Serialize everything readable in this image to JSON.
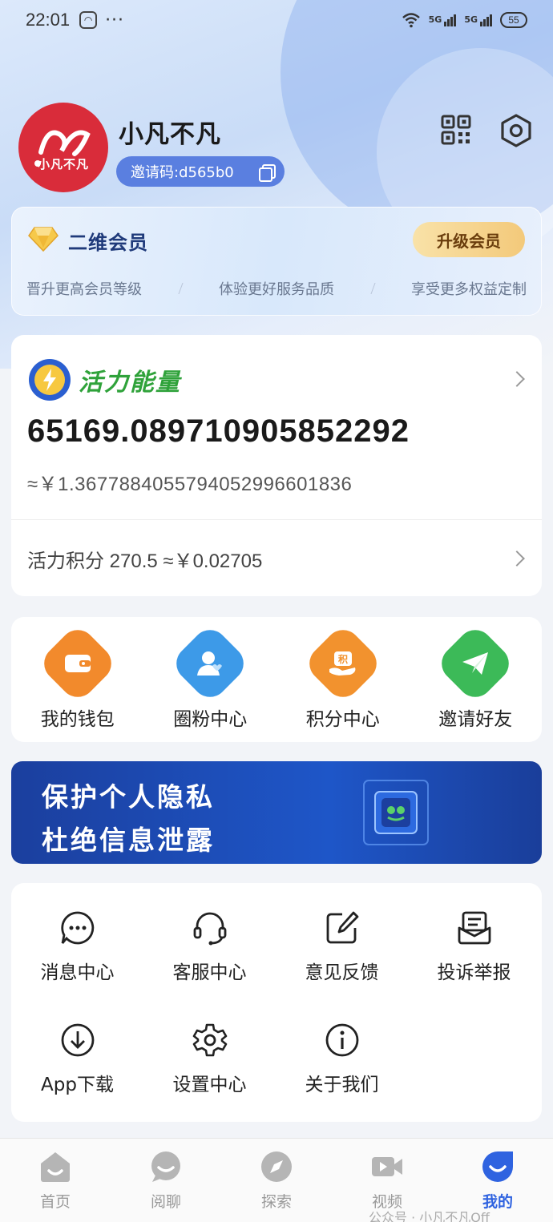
{
  "status_bar": {
    "time": "22:01",
    "dots": "···",
    "signal1": "5G",
    "signal2": "5G",
    "battery": "55"
  },
  "profile": {
    "avatar_text": "小凡不凡",
    "username": "小凡不凡",
    "invite_code": "邀请码:d565b0"
  },
  "membership": {
    "title": "二维会员",
    "upgrade_label": "升级会员",
    "benefits": [
      "晋升更高会员等级",
      "体验更好服务品质",
      "享受更多权益定制"
    ]
  },
  "energy": {
    "title": "活力能量",
    "value": "65169.089710905852292",
    "yuan_value": "≈￥1.3677884055794052996601836",
    "points_text": "活力积分 270.5 ≈￥0.02705"
  },
  "quick_actions": [
    {
      "label": "我的钱包",
      "icon": "wallet-icon",
      "color": "#f28a2c"
    },
    {
      "label": "圈粉中心",
      "icon": "fans-icon",
      "color": "#3d9ae8"
    },
    {
      "label": "积分中心",
      "icon": "points-icon",
      "color": "#f2922e"
    },
    {
      "label": "邀请好友",
      "icon": "paper-plane-icon",
      "color": "#3cba58"
    }
  ],
  "banner": {
    "line1": "保护个人隐私",
    "line2": "杜绝信息泄露"
  },
  "services": [
    {
      "label": "消息中心",
      "icon": "message-icon"
    },
    {
      "label": "客服中心",
      "icon": "headset-icon"
    },
    {
      "label": "意见反馈",
      "icon": "feedback-edit-icon"
    },
    {
      "label": "投诉举报",
      "icon": "complaint-icon"
    },
    {
      "label": "App下载",
      "icon": "download-icon"
    },
    {
      "label": "设置中心",
      "icon": "settings-gear-icon"
    },
    {
      "label": "关于我们",
      "icon": "info-icon"
    }
  ],
  "bottom_nav": [
    {
      "label": "首页",
      "icon": "home-icon",
      "active": false
    },
    {
      "label": "阅聊",
      "icon": "chat-bubble-icon",
      "active": false
    },
    {
      "label": "探索",
      "icon": "compass-icon",
      "active": false
    },
    {
      "label": "视频",
      "icon": "video-icon",
      "active": false
    },
    {
      "label": "我的",
      "icon": "profile-icon",
      "active": true
    }
  ],
  "watermark": "公众号 · 小凡不凡Off",
  "colors": {
    "accent": "#2f63e0",
    "energy_green": "#2fa23a",
    "avatar_red": "#d92c3a"
  }
}
